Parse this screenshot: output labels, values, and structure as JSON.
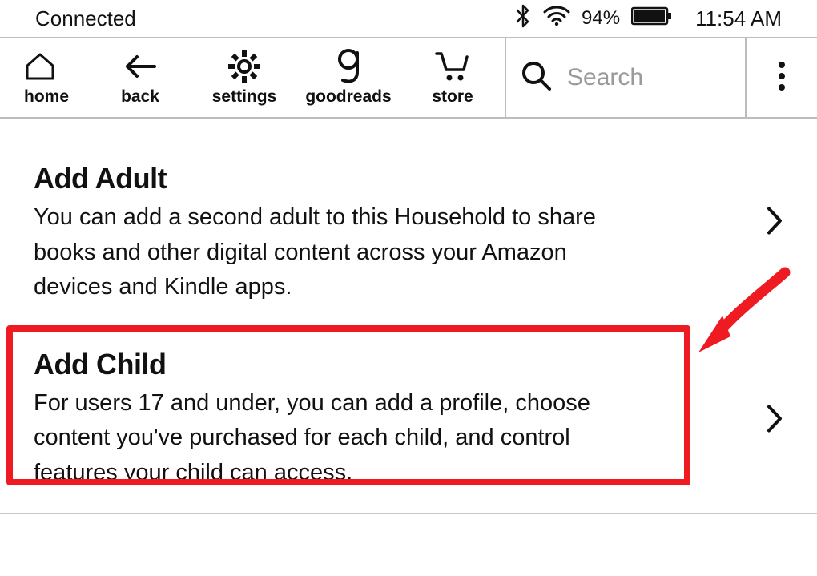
{
  "status": {
    "connection": "Connected",
    "battery_percent": "94%",
    "time": "11:54 AM"
  },
  "toolbar": {
    "home": "home",
    "back": "back",
    "settings": "settings",
    "goodreads": "goodreads",
    "store": "store",
    "search_placeholder": "Search"
  },
  "rows": {
    "add_adult": {
      "title": "Add Adult",
      "desc": "You can add a second adult to this Household to share books and other digital content across your Amazon devices and Kindle apps."
    },
    "add_child": {
      "title": "Add Child",
      "desc": "For users 17 and under, you can add a profile, choose content you've purchased for each child, and control features your child can access."
    }
  },
  "colors": {
    "highlight": "#ee1b23"
  }
}
